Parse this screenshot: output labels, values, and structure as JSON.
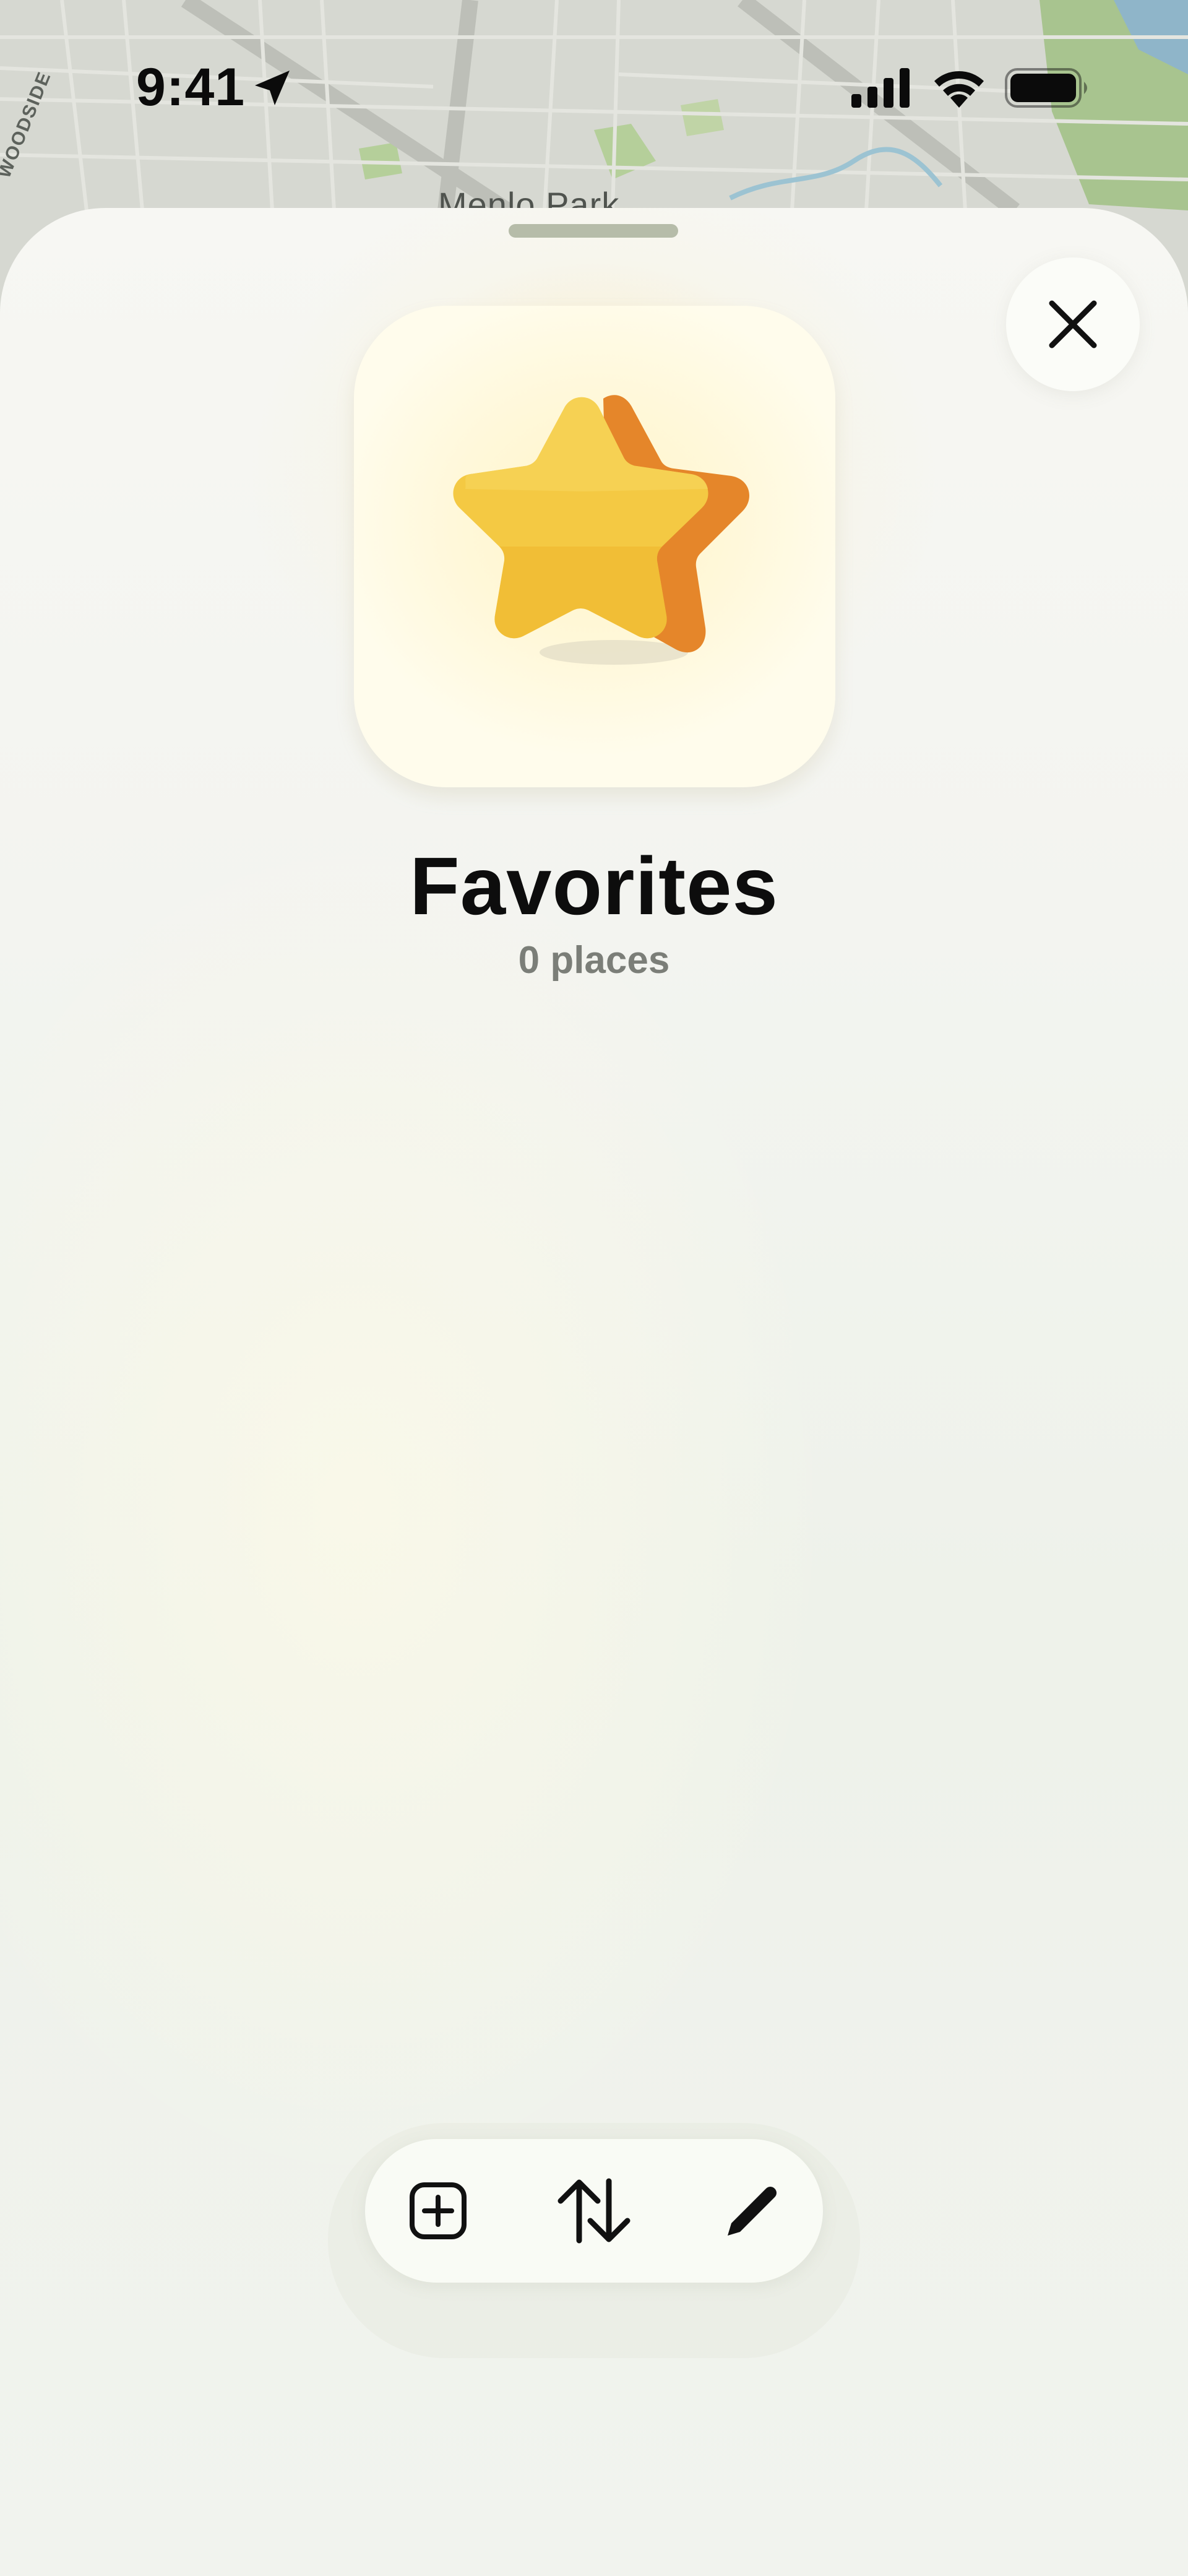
{
  "status_bar": {
    "time": "9:41",
    "location_icon": "location-arrow-icon",
    "signal_icon": "cellular-signal-icon",
    "wifi_icon": "wifi-icon",
    "battery_icon": "battery-icon"
  },
  "map": {
    "labels": {
      "woodside": "WOODSIDE",
      "menlo_park": "Menlo Park"
    }
  },
  "sheet": {
    "grabber": "sheet-grabber",
    "close_icon": "close-icon",
    "collection_icon": "star-icon",
    "title": "Favorites",
    "subtitle": "0 places"
  },
  "toolbar": {
    "add_icon": "plus-square-icon",
    "sort_icon": "sort-arrows-icon",
    "edit_icon": "pencil-icon"
  },
  "colors": {
    "star_fill": "#f5c842",
    "star_side": "#e8862a",
    "tile_bg": "#fff8da",
    "title_text": "#0d0d0d",
    "subtitle_text": "#7b7e78",
    "grabber": "#b6bca9"
  }
}
